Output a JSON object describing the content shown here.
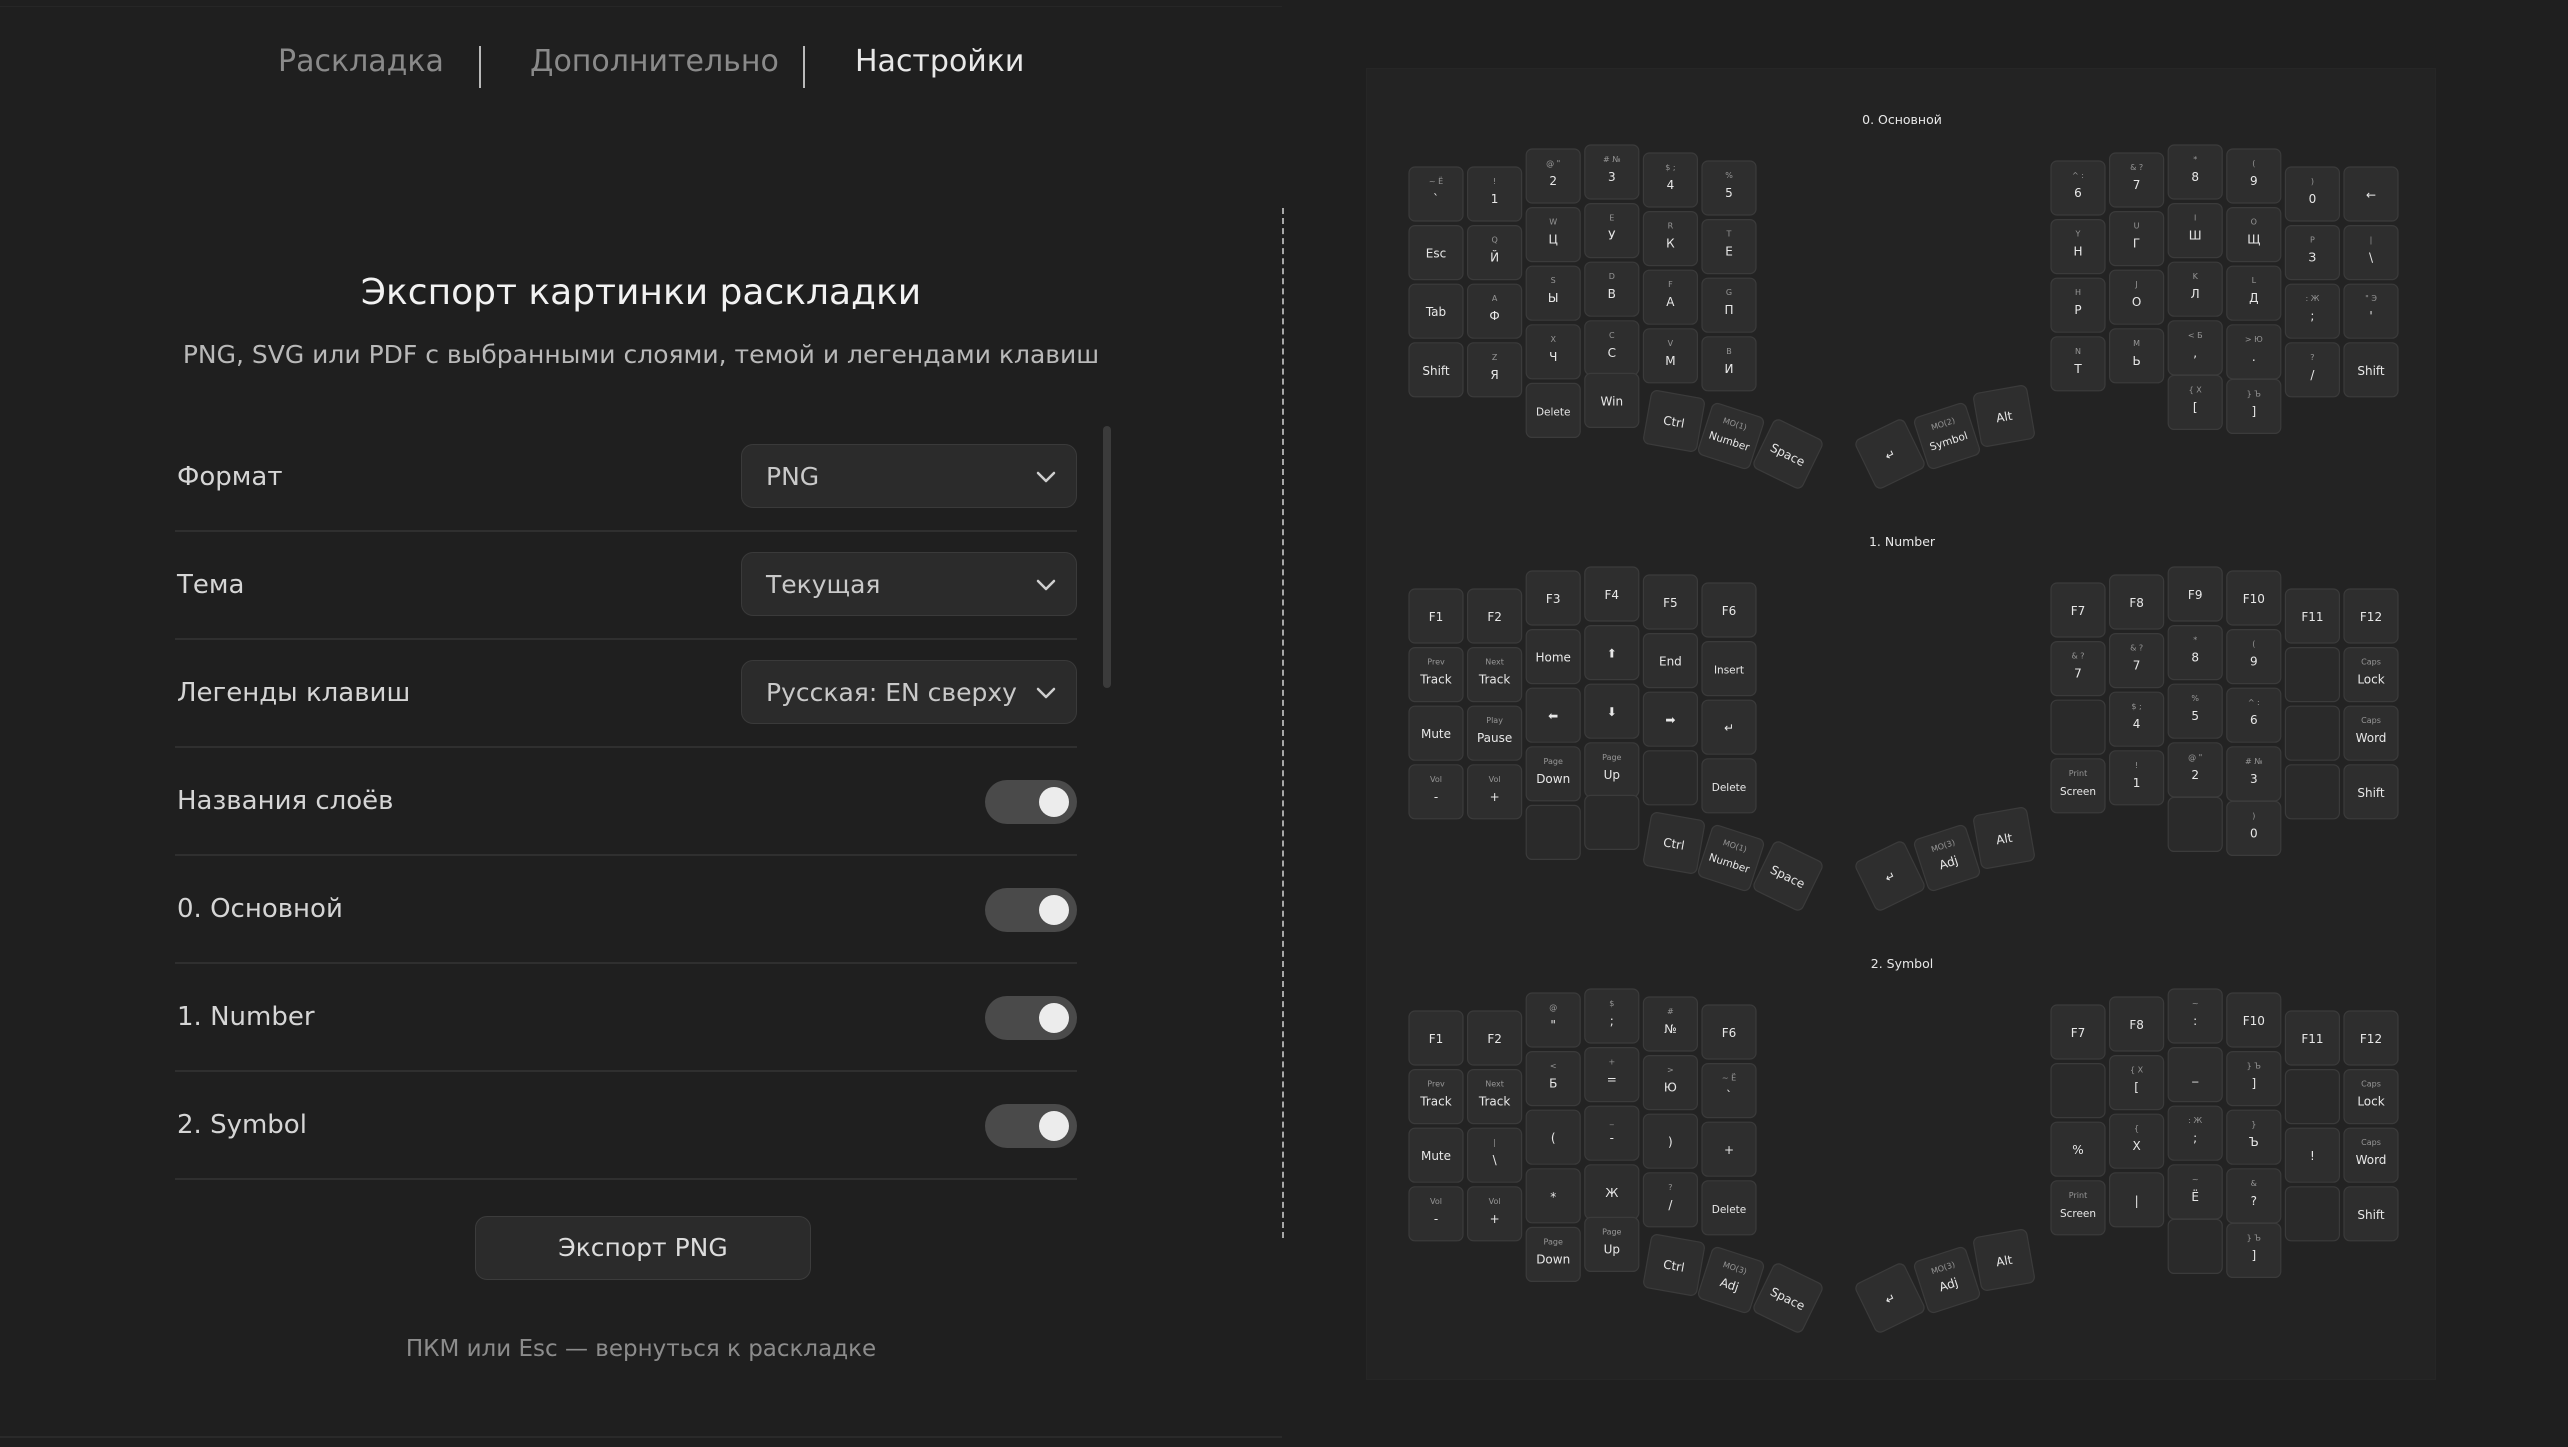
{
  "nav": {
    "tabs": [
      {
        "label": "Раскладка"
      },
      {
        "label": "Дополнительно"
      },
      {
        "label": "Настройки"
      }
    ],
    "active_tab": "Настройки"
  },
  "export": {
    "title": "Экспорт картинки раскладки",
    "subtitle": "PNG, SVG или PDF с выбранными слоями, темой и легендами клавиш",
    "format": {
      "label": "Формат",
      "value": "PNG"
    },
    "theme": {
      "label": "Тема",
      "value": "Текущая"
    },
    "legends": {
      "label": "Легенды клавиш",
      "value": "Русская: EN сверху"
    },
    "toggles": [
      {
        "label": "Названия слоёв",
        "on": true
      },
      {
        "label": "0. Основной",
        "on": true
      },
      {
        "label": "1. Number",
        "on": true
      },
      {
        "label": "2. Symbol",
        "on": true
      }
    ],
    "button_label": "Экспорт PNG",
    "hint": "ПКМ или Esc — вернуться к раскладке"
  },
  "preview": {
    "layers": [
      {
        "title": "0. Основной",
        "left": [
          [
            [
              "~ Ё",
              "`"
            ],
            [
              "!",
              "1"
            ],
            [
              "@ \"",
              "2"
            ],
            [
              "# №",
              "3"
            ],
            [
              "$ ;",
              "4"
            ],
            [
              "%",
              "5"
            ]
          ],
          [
            [
              "",
              "Esc"
            ],
            [
              "Q",
              "Й"
            ],
            [
              "W",
              "Ц"
            ],
            [
              "E",
              "У"
            ],
            [
              "R",
              "К"
            ],
            [
              "T",
              "Е"
            ]
          ],
          [
            [
              "",
              "Tab"
            ],
            [
              "A",
              "Ф"
            ],
            [
              "S",
              "Ы"
            ],
            [
              "D",
              "В"
            ],
            [
              "F",
              "А"
            ],
            [
              "G",
              "П"
            ]
          ],
          [
            [
              "",
              "Shift"
            ],
            [
              "Z",
              "Я"
            ],
            [
              "X",
              "Ч"
            ],
            [
              "C",
              "С"
            ],
            [
              "V",
              "М"
            ],
            [
              "B",
              "И"
            ]
          ]
        ],
        "left_thumbs": [
          [
            "",
            "Delete"
          ],
          [
            "",
            "Win"
          ],
          [
            "",
            "Ctrl"
          ],
          [
            "MO(1)",
            "Number"
          ],
          [
            "",
            "Space"
          ]
        ],
        "right": [
          [
            [
              "^ :",
              "6"
            ],
            [
              "& ?",
              "7"
            ],
            [
              "*",
              "8"
            ],
            [
              "(",
              "9"
            ],
            [
              ")",
              "0"
            ],
            [
              "",
              "←"
            ]
          ],
          [
            [
              "Y",
              "Н"
            ],
            [
              "U",
              "Г"
            ],
            [
              "I",
              "Ш"
            ],
            [
              "O",
              "Щ"
            ],
            [
              "P",
              "З"
            ],
            [
              "|",
              "\\"
            ]
          ],
          [
            [
              "H",
              "Р"
            ],
            [
              "J",
              "О"
            ],
            [
              "K",
              "Л"
            ],
            [
              "L",
              "Д"
            ],
            [
              ": Ж",
              ";"
            ],
            [
              "\" Э",
              "'"
            ]
          ],
          [
            [
              "N",
              "Т"
            ],
            [
              "M",
              "Ь"
            ],
            [
              "< Б",
              ","
            ],
            [
              "> Ю",
              "."
            ],
            [
              "?",
              "/"
            ],
            [
              "",
              "Shift"
            ]
          ]
        ],
        "right_thumbs": [
          [
            "{ Х",
            "["
          ],
          [
            "} Ъ",
            "]"
          ],
          [
            "",
            "Alt"
          ],
          [
            "MO(2)",
            "Symbol"
          ],
          [
            "",
            "↵"
          ]
        ]
      },
      {
        "title": "1. Number",
        "left": [
          [
            [
              "",
              "F1"
            ],
            [
              "",
              "F2"
            ],
            [
              "",
              "F3"
            ],
            [
              "",
              "F4"
            ],
            [
              "",
              "F5"
            ],
            [
              "",
              "F6"
            ]
          ],
          [
            [
              "Prev",
              "Track"
            ],
            [
              "Next",
              "Track"
            ],
            [
              "",
              "Home"
            ],
            [
              "",
              "⬆"
            ],
            [
              "",
              "End"
            ],
            [
              "",
              "Insert"
            ]
          ],
          [
            [
              "",
              "Mute"
            ],
            [
              "Play",
              "Pause"
            ],
            [
              "",
              "⬅"
            ],
            [
              "",
              "⬇"
            ],
            [
              "",
              "➡"
            ],
            [
              "",
              "↵"
            ]
          ],
          [
            [
              "Vol",
              "-"
            ],
            [
              "Vol",
              "+"
            ],
            [
              "Page",
              "Down"
            ],
            [
              "Page",
              "Up"
            ],
            [
              "",
              ""
            ],
            [
              "",
              "Delete"
            ]
          ]
        ],
        "left_thumbs": [
          [
            "",
            ""
          ],
          [
            "",
            ""
          ],
          [
            "",
            "Ctrl"
          ],
          [
            "MO(1)",
            "Number"
          ],
          [
            "",
            "Space"
          ]
        ],
        "right": [
          [
            [
              "",
              "F7"
            ],
            [
              "",
              "F8"
            ],
            [
              "",
              "F9"
            ],
            [
              "",
              "F10"
            ],
            [
              "",
              "F11"
            ],
            [
              "",
              "F12"
            ]
          ],
          [
            [
              "& ?",
              "7"
            ],
            [
              "& ?",
              "7"
            ],
            [
              "*",
              "8"
            ],
            [
              "(",
              "9"
            ],
            [
              "",
              ""
            ],
            [
              "Caps",
              "Lock"
            ]
          ],
          [
            [
              "",
              ""
            ],
            [
              "$ ;",
              "4"
            ],
            [
              "%",
              "5"
            ],
            [
              "^ :",
              "6"
            ],
            [
              "",
              ""
            ],
            [
              "Caps",
              "Word"
            ]
          ],
          [
            [
              "Print",
              "Screen"
            ],
            [
              "!",
              "1"
            ],
            [
              "@ \"",
              "2"
            ],
            [
              "# №",
              "3"
            ],
            [
              "",
              ""
            ],
            [
              "",
              "Shift"
            ]
          ]
        ],
        "right_thumbs": [
          [
            "",
            ""
          ],
          [
            ")",
            "0"
          ],
          [
            "",
            "Alt"
          ],
          [
            "MO(3)",
            "Adj"
          ],
          [
            "",
            "↵"
          ]
        ]
      },
      {
        "title": "2. Symbol",
        "left": [
          [
            [
              "",
              "F1"
            ],
            [
              "",
              "F2"
            ],
            [
              "@",
              "\""
            ],
            [
              "$",
              ";"
            ],
            [
              "#",
              "№"
            ],
            [
              "",
              "F6"
            ]
          ],
          [
            [
              "Prev",
              "Track"
            ],
            [
              "Next",
              "Track"
            ],
            [
              "<",
              "Б"
            ],
            [
              "+",
              "="
            ],
            [
              ">",
              "Ю"
            ],
            [
              "~ Ё",
              "`"
            ]
          ],
          [
            [
              "",
              "Mute"
            ],
            [
              "|",
              "\\"
            ],
            [
              "",
              "("
            ],
            [
              "_",
              "-"
            ],
            [
              "",
              ")"
            ],
            [
              "",
              "+"
            ]
          ],
          [
            [
              "Vol",
              "-"
            ],
            [
              "Vol",
              "+"
            ],
            [
              "",
              "*"
            ],
            [
              "",
              "Ж"
            ],
            [
              "?",
              "/"
            ],
            [
              "",
              "Delete"
            ]
          ]
        ],
        "left_thumbs": [
          [
            "Page",
            "Down"
          ],
          [
            "Page",
            "Up"
          ],
          [
            "",
            "Ctrl"
          ],
          [
            "MO(3)",
            "Adj"
          ],
          [
            "",
            "Space"
          ]
        ],
        "right": [
          [
            [
              "",
              "F7"
            ],
            [
              "",
              "F8"
            ],
            [
              "~",
              ":"
            ],
            [
              "",
              "F10"
            ],
            [
              "",
              "F11"
            ],
            [
              "",
              "F12"
            ]
          ],
          [
            [
              "",
              ""
            ],
            [
              "{ Х",
              "["
            ],
            [
              "",
              "_"
            ],
            [
              "} Ъ",
              "]"
            ],
            [
              "",
              ""
            ],
            [
              "Caps",
              "Lock"
            ]
          ],
          [
            [
              "",
              "%"
            ],
            [
              "{",
              "Х"
            ],
            [
              ": Ж",
              ";"
            ],
            [
              "}",
              "Ъ"
            ],
            [
              "",
              "!"
            ],
            [
              "Caps",
              "Word"
            ]
          ],
          [
            [
              "Print",
              "Screen"
            ],
            [
              "",
              "|"
            ],
            [
              "~",
              "Ё"
            ],
            [
              "&",
              "?"
            ],
            [
              "",
              ""
            ],
            [
              "",
              "Shift"
            ]
          ]
        ],
        "right_thumbs": [
          [
            "",
            ""
          ],
          [
            "} Ъ",
            "]"
          ],
          [
            "",
            "Alt"
          ],
          [
            "MO(3)",
            "Adj"
          ],
          [
            "",
            "↵"
          ]
        ]
      }
    ]
  }
}
